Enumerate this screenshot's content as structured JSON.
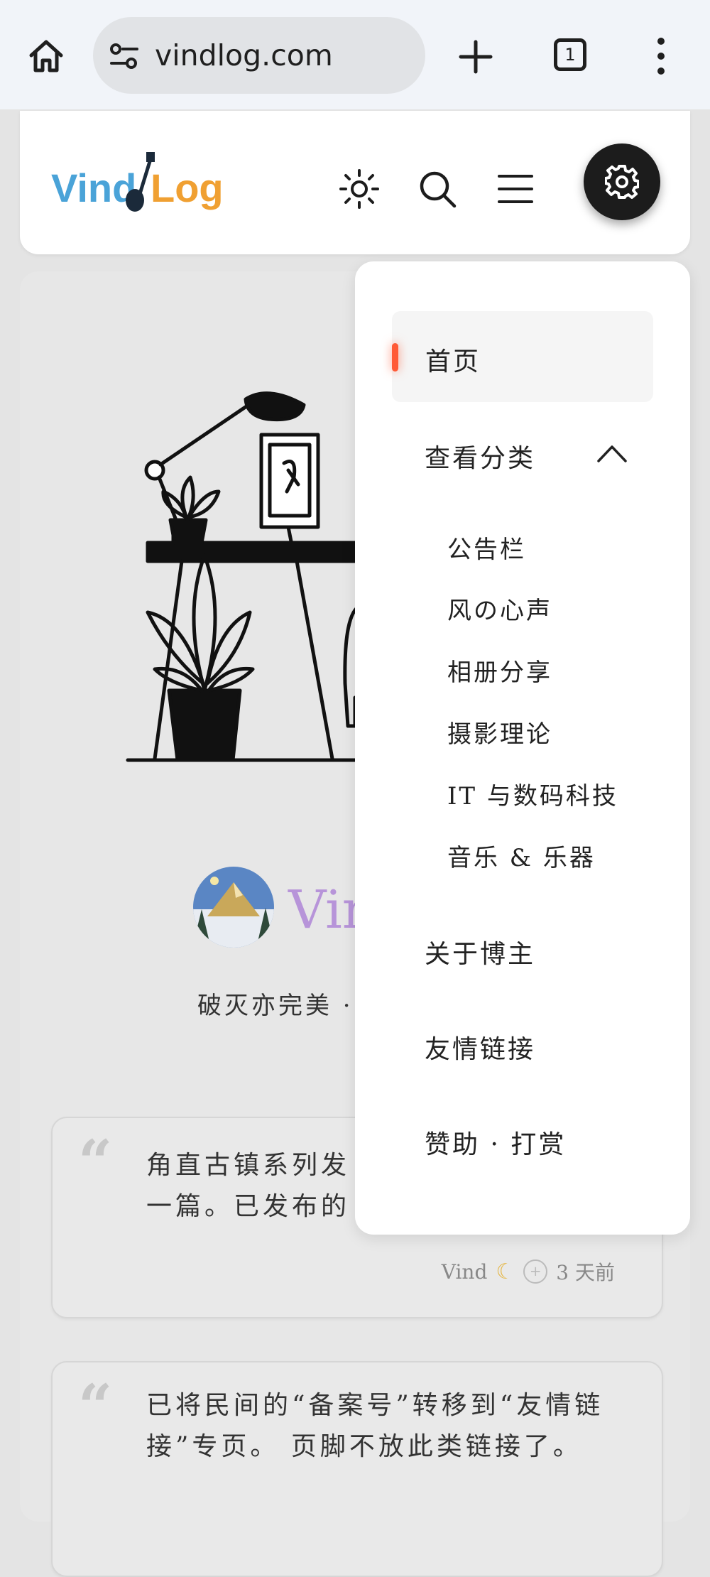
{
  "browser": {
    "url": "vindlog.com",
    "tab_count": "1"
  },
  "header": {
    "logo_text_left": "Vind",
    "logo_text_right": "Log"
  },
  "hero": {
    "site_name": "Vin",
    "motto": "破灭亦完美 ·"
  },
  "notes": [
    {
      "text_line1": "角直古镇系列发",
      "text_line2": "一篇。已发布的",
      "author": "Vind",
      "time": "3 天前"
    },
    {
      "text": "已将民间的“备案号”转移到“友情链接”专页。 页脚不放此类链接了。"
    }
  ],
  "menu": {
    "home": "首页",
    "categories": "查看分类",
    "sub_items": [
      "公告栏",
      "风の心声",
      "相册分享",
      "摄影理论",
      "IT 与数码科技",
      "音乐 & 乐器"
    ],
    "about": "关于博主",
    "links": "友情链接",
    "sponsor": "赞助 · 打赏"
  },
  "colors": {
    "accent": "#ff5a36",
    "site_name": "#b794d9",
    "logo_blue": "#4aa3d8",
    "logo_orange": "#f0a032"
  }
}
